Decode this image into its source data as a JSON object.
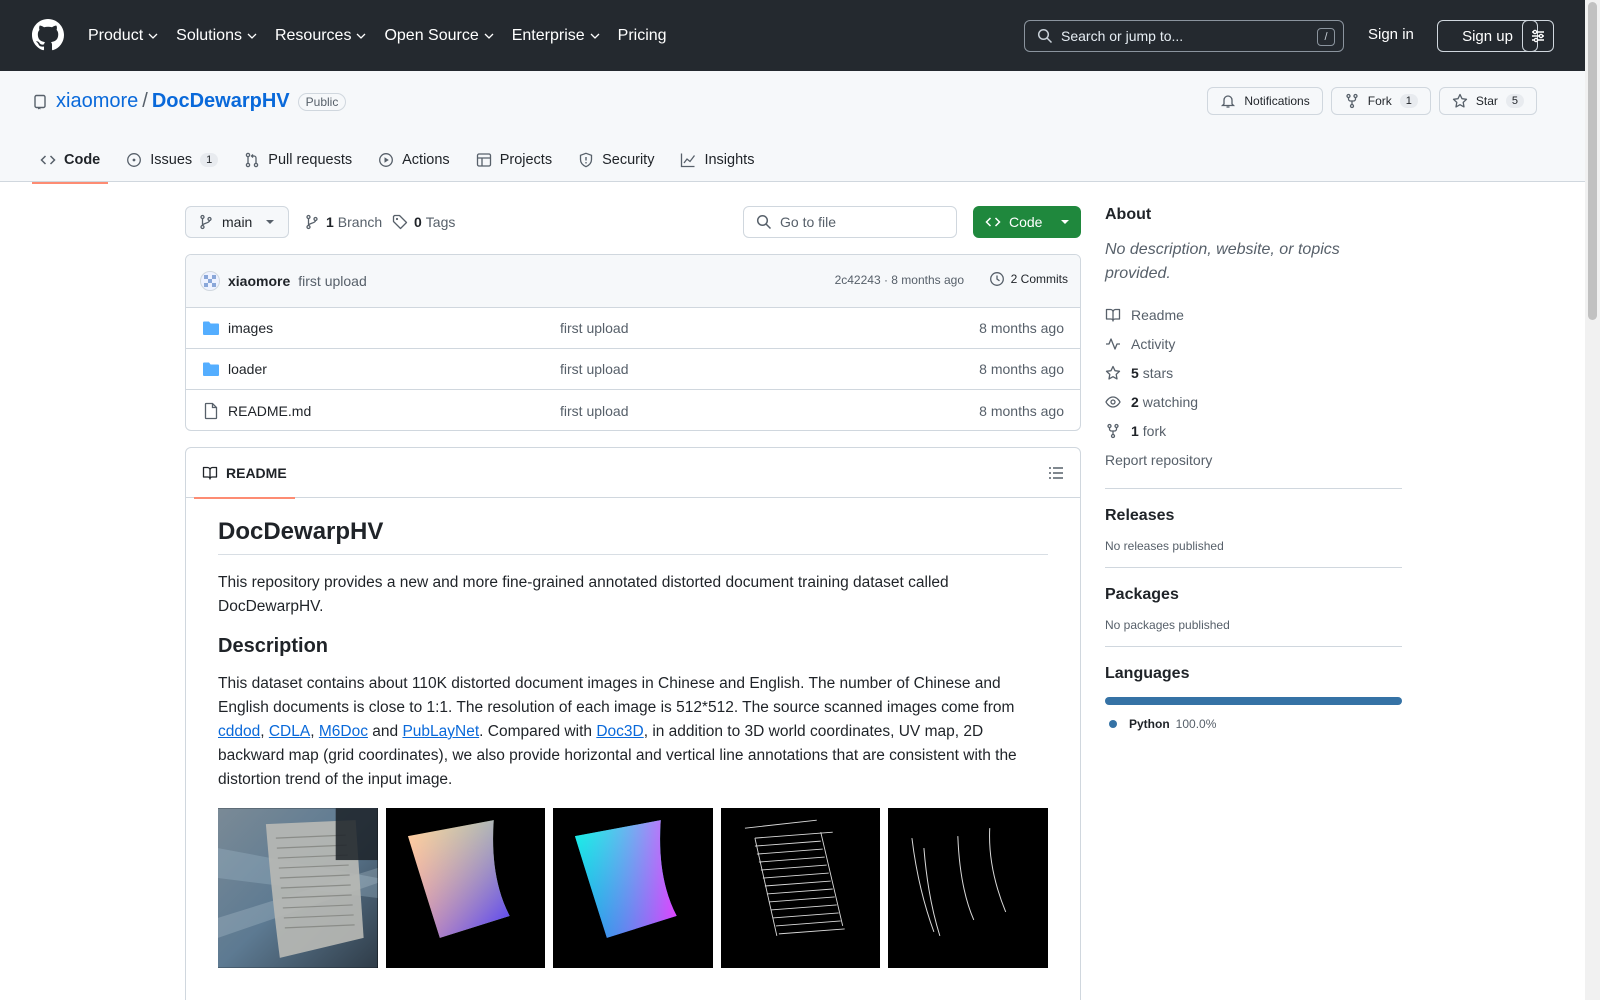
{
  "topnav": {
    "items": [
      "Product",
      "Solutions",
      "Resources",
      "Open Source",
      "Enterprise"
    ],
    "pricing": "Pricing",
    "search_placeholder": "Search or jump to...",
    "search_shortcut": "/",
    "signin": "Sign in",
    "signup": "Sign up"
  },
  "repo": {
    "owner": "xiaomore",
    "separator": "/",
    "name": "DocDewarpHV",
    "visibility": "Public",
    "notifications": "Notifications",
    "fork_label": "Fork",
    "fork_count": "1",
    "star_label": "Star",
    "star_count": "5",
    "tabs": [
      {
        "label": "Code",
        "icon": "code-icon"
      },
      {
        "label": "Issues",
        "icon": "issue-icon",
        "count": "1"
      },
      {
        "label": "Pull requests",
        "icon": "pull-request-icon"
      },
      {
        "label": "Actions",
        "icon": "play-icon"
      },
      {
        "label": "Projects",
        "icon": "table-icon"
      },
      {
        "label": "Security",
        "icon": "shield-icon"
      },
      {
        "label": "Insights",
        "icon": "graph-icon"
      }
    ]
  },
  "branchbar": {
    "branch": "main",
    "branch_count": "1",
    "branch_label": "Branch",
    "tag_count": "0",
    "tag_label": "Tags",
    "goto_placeholder": "Go to file",
    "code_button": "Code"
  },
  "latest_commit": {
    "author": "xiaomore",
    "message": "first upload",
    "meta": "2c42243 · 8 months ago",
    "commits": "2 Commits"
  },
  "files": [
    {
      "name": "images",
      "type": "folder",
      "message": "first upload",
      "time": "8 months ago"
    },
    {
      "name": "loader",
      "type": "folder",
      "message": "first upload",
      "time": "8 months ago"
    },
    {
      "name": "README.md",
      "type": "file",
      "message": "first upload",
      "time": "8 months ago"
    }
  ],
  "readme": {
    "tab": "README",
    "title": "DocDewarpHV",
    "intro": "This repository provides a new and more fine-grained annotated distorted document training dataset called DocDewarpHV.",
    "description_heading": "Description",
    "desc_part1": "This dataset contains about 110K distorted document images in Chinese and English. The number of Chinese and English documents is close to 1:1. The resolution of each image is 512*512. The source scanned images come from ",
    "link_cddod": "cddod",
    "comma1": ", ",
    "link_cdla": "CDLA",
    "comma2": ", ",
    "link_m6doc": "M6Doc",
    "and_text": " and ",
    "link_publaynet": "PubLayNet",
    "desc_part2": ". Compared with ",
    "link_doc3d": "Doc3D",
    "desc_part3": ", in addition to 3D world coordinates, UV map, 2D backward map (grid coordinates), we also provide horizontal and vertical line annotations that are consistent with the distortion trend of the input image."
  },
  "about": {
    "heading": "About",
    "description": "No description, website, or topics provided.",
    "readme": "Readme",
    "activity": "Activity",
    "stars_count": "5",
    "stars_label": "stars",
    "watching_count": "2",
    "watching_label": "watching",
    "fork_count": "1",
    "fork_label": "fork",
    "report": "Report repository"
  },
  "releases": {
    "heading": "Releases",
    "text": "No releases published"
  },
  "packages": {
    "heading": "Packages",
    "text": "No packages published"
  },
  "languages": {
    "heading": "Languages",
    "name": "Python",
    "percent": "100.0%",
    "color": "#3572a5"
  },
  "colors": {
    "header_bg": "#24292f",
    "accent": "#0969da",
    "code_button": "#1f883d",
    "tab_underline": "#fd8c73"
  }
}
